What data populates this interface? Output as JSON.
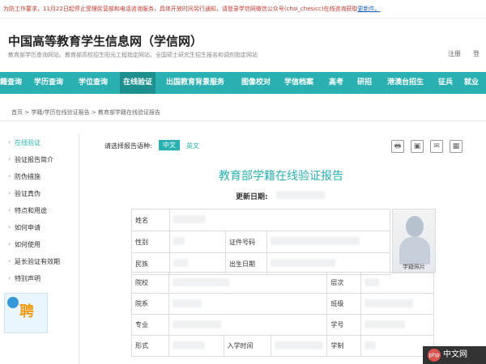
{
  "notice": {
    "text": "为防工作要求，11月22日起停止受理民营部和电话咨询服务，具体开放时间另行通知，请登录学信网微信公众号(chsi_chesicc)在线咨询获取",
    "link": "更新件。"
  },
  "header": {
    "title": "中国高等教育学生信息网（学信网）",
    "subtitle": "教育部学历查询网站、教育部高校招生阳光工程指定网站、全国硕士研究生招生报名和调剂指定网站",
    "register": "注册",
    "login": "登"
  },
  "nav": {
    "items": [
      "籍查询",
      "学历查询",
      "学位查询",
      "在线验证",
      "出国教育背景服务",
      "图像校对",
      "学信档案",
      "高考",
      "研招",
      "港澳台招生",
      "征兵",
      "就业"
    ]
  },
  "breadcrumb": "首页 > 学籍/学历在线验证报告 > 教育部学籍在线验证报告",
  "sidebar": {
    "items": [
      "在线验证",
      "验证报告简介",
      "防伪措施",
      "验证真伪",
      "特点和用途",
      "如何申请",
      "如何使用",
      "延长验证有效期",
      "特别声明"
    ],
    "banner_text": "聘"
  },
  "report": {
    "lang_label": "请选择报告语种:",
    "lang_zh": "中文",
    "lang_en": "英文",
    "title": "教育部学籍在线验证报告",
    "update_label": "更新日期:"
  },
  "fields": {
    "name": "姓名",
    "gender": "性别",
    "id_number": "证件号码",
    "ethnicity": "民族",
    "birth_date": "出生日期",
    "photo_caption": "学籍照片",
    "school": "院校",
    "level": "层次",
    "department": "院系",
    "class": "班级",
    "major": "专业",
    "student_no": "学号",
    "form": "形式",
    "enroll_date": "入学时间",
    "duration": "学制"
  },
  "tools": {
    "print": "🖶",
    "save": "▣",
    "mail": "✉",
    "qr": "▦"
  },
  "watermark": {
    "logo": "php",
    "text": "中文网"
  }
}
